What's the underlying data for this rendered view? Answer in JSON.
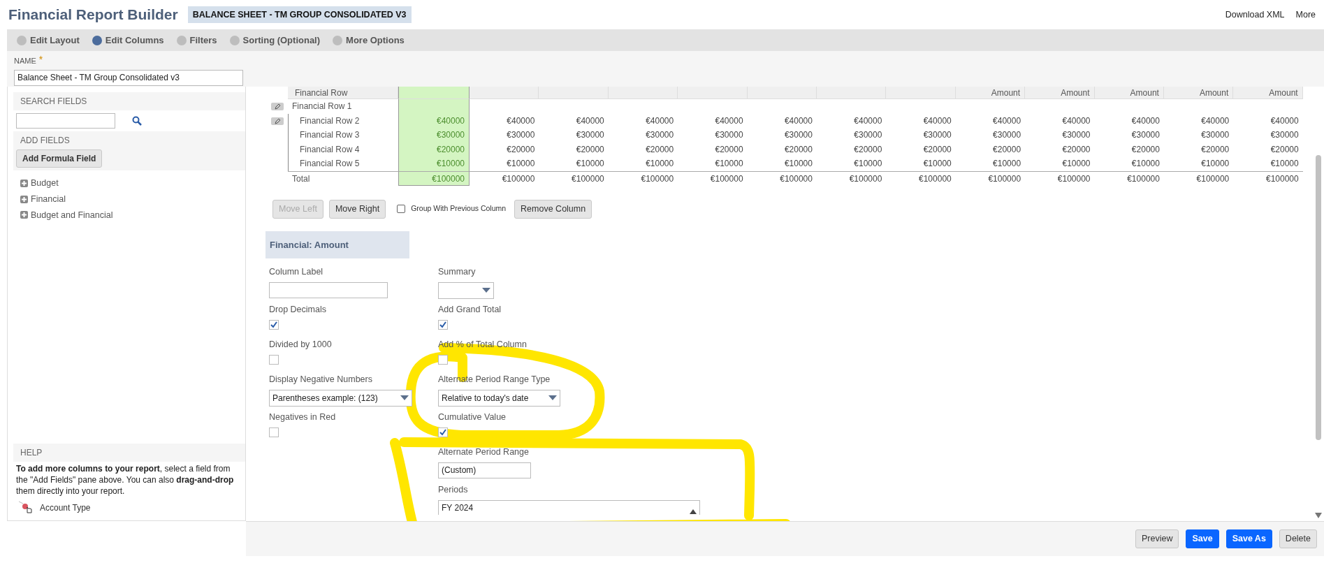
{
  "header": {
    "title": "Financial Report Builder",
    "report_badge": "BALANCE SHEET - TM GROUP CONSOLIDATED V3",
    "links": [
      "Download XML",
      "More"
    ]
  },
  "steps": [
    {
      "label": "Edit Layout",
      "selected": false
    },
    {
      "label": "Edit Columns",
      "selected": true
    },
    {
      "label": "Filters",
      "selected": false
    },
    {
      "label": "Sorting (Optional)",
      "selected": false
    },
    {
      "label": "More Options",
      "selected": false
    }
  ],
  "name_field": {
    "label": "NAME",
    "required_mark": "*",
    "value": "Balance Sheet - TM Group Consolidated v3"
  },
  "sidebar": {
    "search_heading": "SEARCH FIELDS",
    "add_heading": "ADD FIELDS",
    "add_button": "Add Formula Field",
    "tree": [
      {
        "label": "Budget",
        "expanded": false
      },
      {
        "label": "Financial",
        "expanded": false
      },
      {
        "label": "Budget and Financial",
        "expanded": false
      }
    ],
    "help_heading": "HELP",
    "help_text": "**To add more columns to your report**, select a field from the \"Add Fields\" pane above. You can also **drag-and-drop** them directly into your report.",
    "drag_item": "Account Type"
  },
  "table": {
    "row_header": "Financial Row",
    "columns": [
      {
        "selected": true
      },
      {
        "selected": false
      },
      {
        "selected": false
      },
      {
        "selected": false
      },
      {
        "selected": false
      },
      {
        "selected": false
      },
      {
        "selected": false
      },
      {
        "selected": false
      },
      {
        "header": "Amount",
        "selected": false
      },
      {
        "header": "Amount",
        "selected": false
      },
      {
        "header": "Amount",
        "selected": false
      },
      {
        "header": "Amount",
        "selected": false
      },
      {
        "header": "Amount",
        "selected": false
      }
    ],
    "rows": [
      {
        "label": "Financial Row 1",
        "editable": true,
        "children": [
          {
            "label": "Financial Row 2",
            "editable": true,
            "values": [
              "€40000",
              "€40000",
              "€40000",
              "€40000",
              "€40000",
              "€40000",
              "€40000",
              "€40000",
              "€40000",
              "€40000",
              "€40000",
              "€40000",
              "€40000"
            ]
          },
          {
            "label": "Financial Row 3",
            "editable": false,
            "values": [
              "€30000",
              "€30000",
              "€30000",
              "€30000",
              "€30000",
              "€30000",
              "€30000",
              "€30000",
              "€30000",
              "€30000",
              "€30000",
              "€30000",
              "€30000"
            ]
          },
          {
            "label": "Financial Row 4",
            "editable": false,
            "values": [
              "€20000",
              "€20000",
              "€20000",
              "€20000",
              "€20000",
              "€20000",
              "€20000",
              "€20000",
              "€20000",
              "€20000",
              "€20000",
              "€20000",
              "€20000"
            ]
          },
          {
            "label": "Financial Row 5",
            "editable": false,
            "values": [
              "€10000",
              "€10000",
              "€10000",
              "€10000",
              "€10000",
              "€10000",
              "€10000",
              "€10000",
              "€10000",
              "€10000",
              "€10000",
              "€10000",
              "€10000"
            ]
          }
        ]
      }
    ],
    "total": {
      "label": "Total",
      "values": [
        "€100000",
        "€100000",
        "€100000",
        "€100000",
        "€100000",
        "€100000",
        "€100000",
        "€100000",
        "€100000",
        "€100000",
        "€100000",
        "€100000",
        "€100000"
      ]
    }
  },
  "column_controls": {
    "buttons": [
      {
        "label": "Move Left",
        "disabled": true
      },
      {
        "label": "Move Right",
        "disabled": false
      }
    ],
    "group_checkbox": {
      "label": "Group With Previous Column",
      "checked": false
    },
    "remove_button": "Remove Column"
  },
  "section_title": "Financial: Amount",
  "form": {
    "left": [
      {
        "kind": "text",
        "label": "Column Label"
      },
      {
        "kind": "checkbox",
        "label": "Drop Decimals",
        "checked": true
      },
      {
        "kind": "checkbox",
        "label": "Divided by 1000",
        "checked": false
      },
      {
        "kind": "select",
        "label": "Display Negative Numbers",
        "value": "Parentheses  example: (123)"
      },
      {
        "kind": "checkbox",
        "label": "Negatives in Red",
        "checked": false
      }
    ],
    "right": [
      {
        "kind": "select",
        "label": "Summary"
      },
      {
        "kind": "checkbox",
        "label": "Add Grand Total",
        "checked": true
      },
      {
        "kind": "checkbox",
        "label": "Add % of Total Column",
        "checked": false
      },
      {
        "kind": "select",
        "label": "Alternate Period Range Type",
        "value": "Relative to today's date"
      },
      {
        "kind": "checkbox",
        "label": "Cumulative Value",
        "checked": true
      },
      {
        "kind": "text",
        "label": "Alternate Period Range",
        "value": "(Custom)"
      },
      {
        "kind": "multiselect",
        "label": "Periods",
        "value": "FY 2024"
      }
    ]
  },
  "footer_buttons": [
    {
      "label": "Preview",
      "kind": "secondary"
    },
    {
      "label": "Save",
      "kind": "primary"
    },
    {
      "label": "Save As",
      "kind": "primary"
    },
    {
      "label": "Delete",
      "kind": "secondary"
    }
  ]
}
